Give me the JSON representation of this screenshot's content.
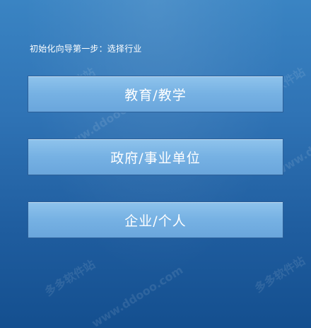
{
  "wizard": {
    "step_title": "初始化向导第一步：选择行业",
    "options": [
      {
        "label": "教育/教学"
      },
      {
        "label": "政府/事业单位"
      },
      {
        "label": "企业/个人"
      }
    ]
  },
  "watermarks": {
    "site_name": "多多软件站",
    "site_url": "www.ddooo.com"
  },
  "colors": {
    "background_top": "#3a84c3",
    "background_bottom": "#144f8f",
    "button_fill": "#7fb8e7",
    "button_border": "#2c5f98",
    "text": "#ffffff"
  }
}
